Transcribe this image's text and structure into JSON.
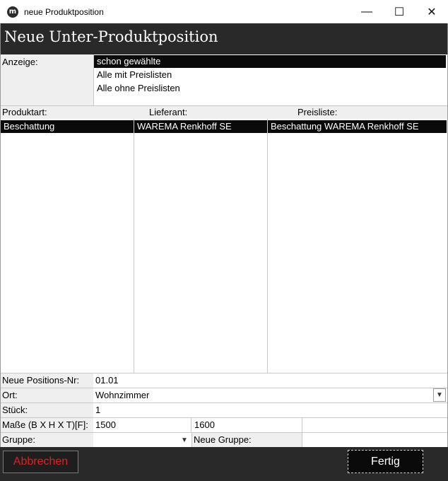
{
  "window": {
    "title": "neue Produktposition",
    "icon_glyph": "m",
    "minimize": "—",
    "maximize": "☐",
    "close": "✕"
  },
  "header": {
    "title": "Neue Unter-Produktposition"
  },
  "anzeige": {
    "label": "Anzeige:",
    "options": [
      "schon gewählte",
      "Alle mit Preislisten",
      "Alle ohne Preislisten"
    ],
    "selected_index": 0
  },
  "columns": {
    "produktart": "Produktart:",
    "lieferant": "Lieferant:",
    "preisliste": "Preisliste:"
  },
  "lists": {
    "produktart": [
      "Beschattung"
    ],
    "lieferant": [
      "WAREMA Renkhoff SE"
    ],
    "preisliste": [
      "Beschattung WAREMA Renkhoff SE"
    ]
  },
  "form": {
    "positions_nr": {
      "label": "Neue Positions-Nr:",
      "value": "01.01"
    },
    "ort": {
      "label": "Ort:",
      "value": "Wohnzimmer"
    },
    "stueck": {
      "label": "Stück:",
      "value": "1"
    },
    "masse": {
      "label": "Maße (B X H X T)[F]:",
      "b": "1500",
      "h": "1600",
      "t": ""
    },
    "gruppe": {
      "label": "Gruppe:",
      "value": "",
      "neue_gruppe_label": "Neue Gruppe:",
      "neue_gruppe_value": ""
    }
  },
  "buttons": {
    "cancel": "Abbrechen",
    "done": "Fertig"
  },
  "colors": {
    "header_bg": "#292929",
    "selection_bg": "#0a0a0a",
    "cancel_text": "#e02020",
    "label_bg": "#efefef"
  }
}
